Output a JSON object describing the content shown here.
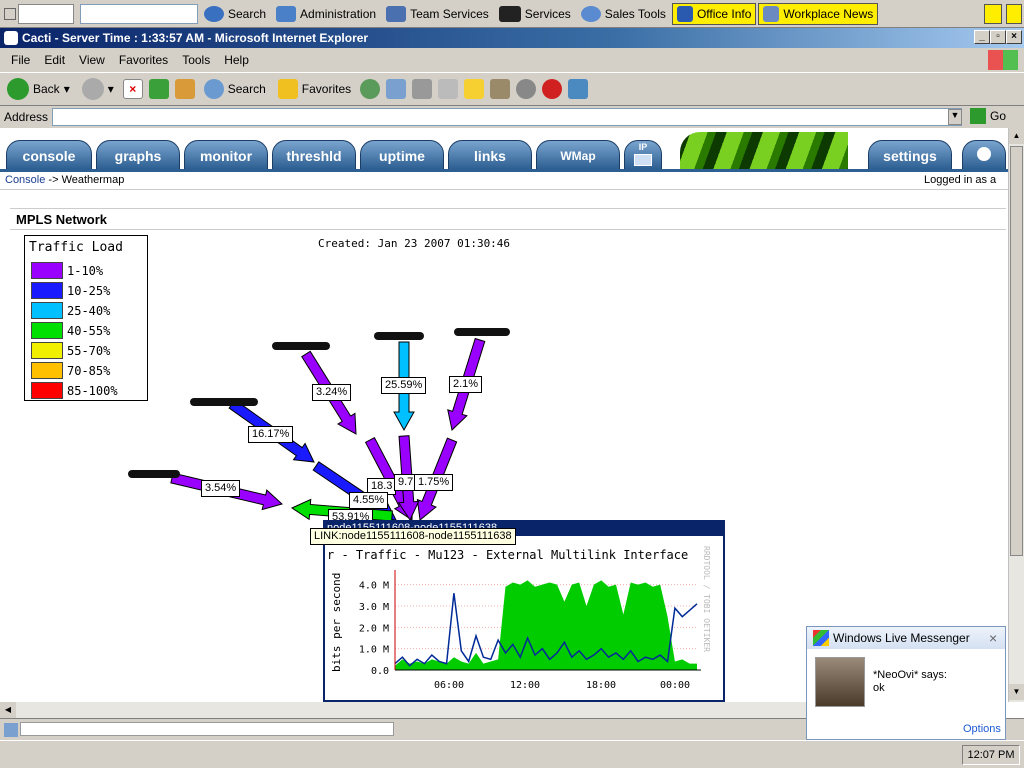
{
  "toolbar_top": {
    "search": "Search",
    "admin": "Administration",
    "team": "Team Services",
    "services": "Services",
    "sales": "Sales Tools",
    "office": "Office Info",
    "workplace": "Workplace News"
  },
  "window": {
    "title": "Cacti - Server Time : 1:33:57 AM - Microsoft Internet Explorer"
  },
  "menu": [
    "File",
    "Edit",
    "View",
    "Favorites",
    "Tools",
    "Help"
  ],
  "ie_toolbar": {
    "back": "Back",
    "search": "Search",
    "favorites": "Favorites"
  },
  "address": {
    "label": "Address",
    "go": "Go"
  },
  "tabs": [
    "console",
    "graphs",
    "monitor",
    "threshld",
    "uptime",
    "links",
    "WMap",
    "settings"
  ],
  "tab_ip": "IP",
  "breadcrumb": {
    "root": "Console",
    "sep": " -> ",
    "current": "Weathermap",
    "user": "Logged in as a"
  },
  "panel_title": "MPLS Network",
  "legend": {
    "title": "Traffic Load",
    "items": [
      {
        "label": "1-10%",
        "color": "#9900ff"
      },
      {
        "label": "10-25%",
        "color": "#1a1aff"
      },
      {
        "label": "25-40%",
        "color": "#00c0ff"
      },
      {
        "label": "40-55%",
        "color": "#00e000"
      },
      {
        "label": "55-70%",
        "color": "#f0f000"
      },
      {
        "label": "70-85%",
        "color": "#ffc000"
      },
      {
        "label": "85-100%",
        "color": "#ff0000"
      }
    ]
  },
  "created": "Created: Jan 23 2007 01:30:46",
  "links": [
    {
      "label": "3.24%",
      "color": "#9900ff"
    },
    {
      "label": "25.59%",
      "color": "#00c0ff"
    },
    {
      "label": "2.1%",
      "color": "#9900ff"
    },
    {
      "label": "16.17%",
      "color": "#1a1aff"
    },
    {
      "label": "3.54%",
      "color": "#9900ff"
    },
    {
      "label": "18.3",
      "color": "#1a1aff"
    },
    {
      "label": "9.7",
      "color": "#9900ff"
    },
    {
      "label": "1.75%",
      "color": "#9900ff"
    },
    {
      "label": "4.55%",
      "color": "#9900ff"
    },
    {
      "label": "53.91%",
      "color": "#00e000"
    }
  ],
  "popup": {
    "header": "node1155111608-node1155111638",
    "tooltip": "LINK:node1155111608-node1155111638",
    "graph_title": "r - Traffic - Mu123 - External Multilink Interface",
    "ylabel": "bits per second",
    "side_text": "RRDTOOL / TOBI OETIKER",
    "yticks": [
      "4.0 M",
      "3.0 M",
      "2.0 M",
      "1.0 M",
      "0.0"
    ],
    "xticks": [
      "06:00",
      "12:00",
      "18:00",
      "00:00"
    ]
  },
  "chart_data": {
    "type": "area",
    "title": "r - Traffic - Mu123 - External Multilink Interface",
    "ylabel": "bits per second",
    "ylim": [
      0,
      4.5
    ],
    "x_ticks": [
      "06:00",
      "12:00",
      "18:00",
      "00:00"
    ],
    "series": [
      {
        "color": "#00cc00",
        "values": [
          0.2,
          0.5,
          0.3,
          0.4,
          0.3,
          0.5,
          0.4,
          0.3,
          0.6,
          0.4,
          0.3,
          0.8,
          0.3,
          0.4,
          0.5,
          3.9,
          4.1,
          4.0,
          4.2,
          3.9,
          4.0,
          4.1,
          4.0,
          3.2,
          4.0,
          4.1,
          3.0,
          4.0,
          4.2,
          3.9,
          4.0,
          2.6,
          4.1,
          4.0,
          4.1,
          3.9,
          4.0,
          2.5,
          0.4,
          0.5,
          0.3,
          0.3
        ]
      },
      {
        "color": "#002a97",
        "values": [
          0.3,
          0.6,
          0.2,
          0.5,
          0.3,
          0.7,
          0.4,
          0.3,
          3.6,
          0.9,
          0.4,
          1.6,
          0.6,
          0.5,
          1.4,
          0.8,
          1.2,
          0.6,
          1.5,
          0.7,
          1.0,
          0.5,
          0.8,
          1.3,
          0.6,
          0.9,
          0.5,
          0.7,
          1.0,
          0.6,
          0.8,
          0.5,
          0.9,
          0.4,
          0.6,
          0.5,
          0.7,
          0.4,
          2.9,
          2.5,
          2.8,
          3.1
        ]
      }
    ]
  },
  "scrollbar": {
    "up": "▲",
    "down": "▼",
    "left": "◀"
  },
  "messenger": {
    "title": "Windows Live Messenger",
    "says": "*NeoOvi* says:",
    "msg": "ok",
    "options": "Options"
  },
  "clock": "12:07 PM"
}
